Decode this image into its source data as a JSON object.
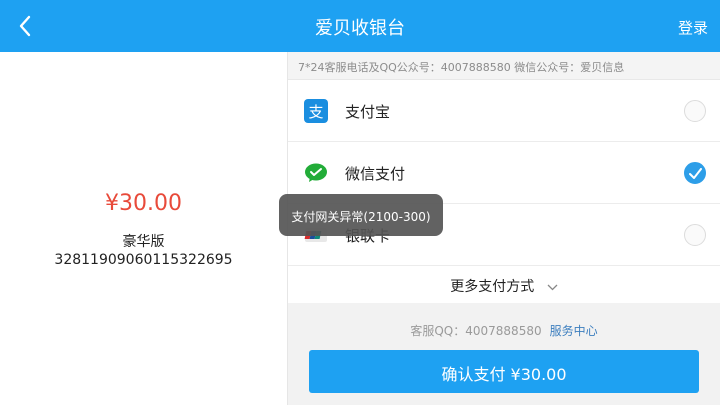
{
  "header": {
    "title": "爱贝收银台",
    "login": "登录"
  },
  "order": {
    "price": "¥30.00",
    "plan": "豪华版",
    "order_no": "32811909060115322695"
  },
  "info": {
    "text": "7*24客服电话及QQ公众号：4007888580 微信公众号：爱贝信息"
  },
  "methods": [
    {
      "label": "支付宝",
      "icon": "alipay-icon",
      "checked": false
    },
    {
      "label": "微信支付",
      "icon": "wechat-pay-icon",
      "checked": true
    },
    {
      "label": "银联卡",
      "icon": "unionpay-icon",
      "checked": false
    }
  ],
  "more": {
    "label": "更多支付方式"
  },
  "support": {
    "qq": "客服QQ：4007888580",
    "link": "服务中心"
  },
  "pay_button": {
    "label": "确认支付 ¥30.00"
  },
  "toast": {
    "text": "支付网关异常(2100-300)"
  },
  "colors": {
    "brand": "#1ea1f2",
    "price": "#e84a3a",
    "check": "#2d9ee8"
  }
}
